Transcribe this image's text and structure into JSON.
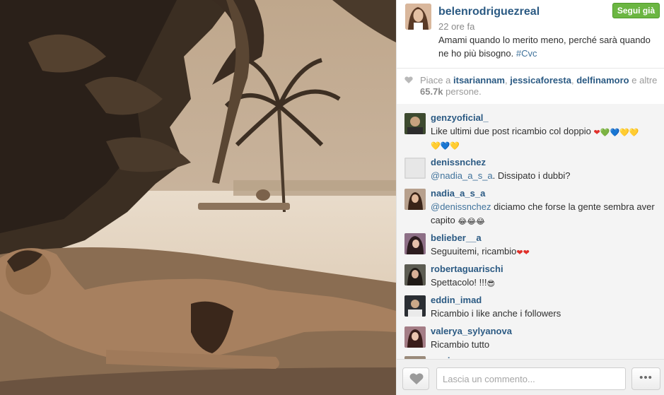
{
  "post": {
    "username": "belenrodriguezreal",
    "follow_label": "Segui già",
    "time": "22 ore fa",
    "caption": "Amami quando lo merito meno, perché sarà quando ne ho più bisogno.",
    "hashtag": "#Cvc"
  },
  "likes": {
    "prefix": "Piace a",
    "users": [
      "itsariannam",
      "jessicaforesta",
      "delfinamoro"
    ],
    "sep": ",",
    "and_others": "e altre",
    "count": "65.7k",
    "suffix": "persone."
  },
  "comments": [
    {
      "username": "genzyoficial_",
      "text": "Like ultimi due post ricambio col doppio",
      "emojis": [
        "❤",
        "💚",
        "💙",
        "💛",
        "💛",
        "💛",
        "💙",
        "💛"
      ]
    },
    {
      "username": "denissnchez",
      "mention": "@nadia_a_s_a",
      "text": ". Dissipato i dubbi?"
    },
    {
      "username": "nadia_a_s_a",
      "mention": "@denissnchez",
      "text": " diciamo che forse la gente sembra aver capito",
      "emojis": [
        "😂",
        "😂",
        "😂"
      ]
    },
    {
      "username": "belieber__a",
      "text": "Seguuitemi, ricambio",
      "emojis": [
        "❤",
        "❤"
      ]
    },
    {
      "username": "robertaguarischi",
      "text": "Spettacolo! !!!",
      "emojis": [
        "😎"
      ]
    },
    {
      "username": "eddin_imad",
      "text": "Ricambio i like anche i followers"
    },
    {
      "username": "valerya_sylyanova",
      "text": "Ricambio tutto"
    },
    {
      "username": "mariopuzzo"
    }
  ],
  "footer": {
    "comment_placeholder": "Lascia un commento...",
    "more_label": "•••"
  },
  "colors": {
    "username": "#2b5a83",
    "follow_button": "#6bb642",
    "hashtag": "#3f729b"
  },
  "icons": {
    "likes": "heart-icon",
    "like_button": "heart-icon",
    "more_button": "ellipsis-icon"
  }
}
